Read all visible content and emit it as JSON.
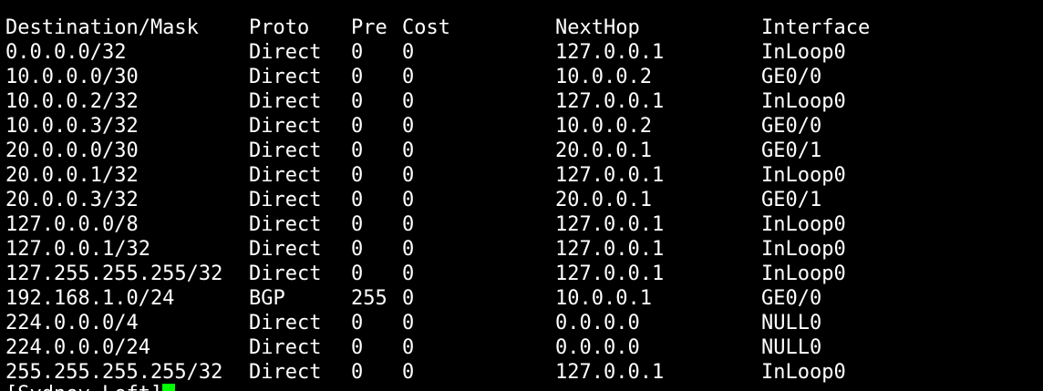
{
  "terminal": {
    "headers": {
      "dest": "Destination/Mask",
      "proto": "Proto",
      "pre": "Pre",
      "cost": "Cost",
      "nexthop": "NextHop",
      "iface": "Interface"
    },
    "rows": [
      {
        "dest": "0.0.0.0/32",
        "proto": "Direct",
        "pre": "0",
        "cost": "0",
        "nexthop": "127.0.0.1",
        "iface": "InLoop0"
      },
      {
        "dest": "10.0.0.0/30",
        "proto": "Direct",
        "pre": "0",
        "cost": "0",
        "nexthop": "10.0.0.2",
        "iface": "GE0/0"
      },
      {
        "dest": "10.0.0.2/32",
        "proto": "Direct",
        "pre": "0",
        "cost": "0",
        "nexthop": "127.0.0.1",
        "iface": "InLoop0"
      },
      {
        "dest": "10.0.0.3/32",
        "proto": "Direct",
        "pre": "0",
        "cost": "0",
        "nexthop": "10.0.0.2",
        "iface": "GE0/0"
      },
      {
        "dest": "20.0.0.0/30",
        "proto": "Direct",
        "pre": "0",
        "cost": "0",
        "nexthop": "20.0.0.1",
        "iface": "GE0/1"
      },
      {
        "dest": "20.0.0.1/32",
        "proto": "Direct",
        "pre": "0",
        "cost": "0",
        "nexthop": "127.0.0.1",
        "iface": "InLoop0"
      },
      {
        "dest": "20.0.0.3/32",
        "proto": "Direct",
        "pre": "0",
        "cost": "0",
        "nexthop": "20.0.0.1",
        "iface": "GE0/1"
      },
      {
        "dest": "127.0.0.0/8",
        "proto": "Direct",
        "pre": "0",
        "cost": "0",
        "nexthop": "127.0.0.1",
        "iface": "InLoop0"
      },
      {
        "dest": "127.0.0.1/32",
        "proto": "Direct",
        "pre": "0",
        "cost": "0",
        "nexthop": "127.0.0.1",
        "iface": "InLoop0"
      },
      {
        "dest": "127.255.255.255/32",
        "proto": "Direct",
        "pre": "0",
        "cost": "0",
        "nexthop": "127.0.0.1",
        "iface": "InLoop0"
      },
      {
        "dest": "192.168.1.0/24",
        "proto": "BGP",
        "pre": "255",
        "cost": "0",
        "nexthop": "10.0.0.1",
        "iface": "GE0/0"
      },
      {
        "dest": "224.0.0.0/4",
        "proto": "Direct",
        "pre": "0",
        "cost": "0",
        "nexthop": "0.0.0.0",
        "iface": "NULL0"
      },
      {
        "dest": "224.0.0.0/24",
        "proto": "Direct",
        "pre": "0",
        "cost": "0",
        "nexthop": "0.0.0.0",
        "iface": "NULL0"
      },
      {
        "dest": "255.255.255.255/32",
        "proto": "Direct",
        "pre": "0",
        "cost": "0",
        "nexthop": "127.0.0.1",
        "iface": "InLoop0"
      }
    ],
    "prompt": "[Sydney-Left]",
    "cursor_color": "#00ff00"
  }
}
